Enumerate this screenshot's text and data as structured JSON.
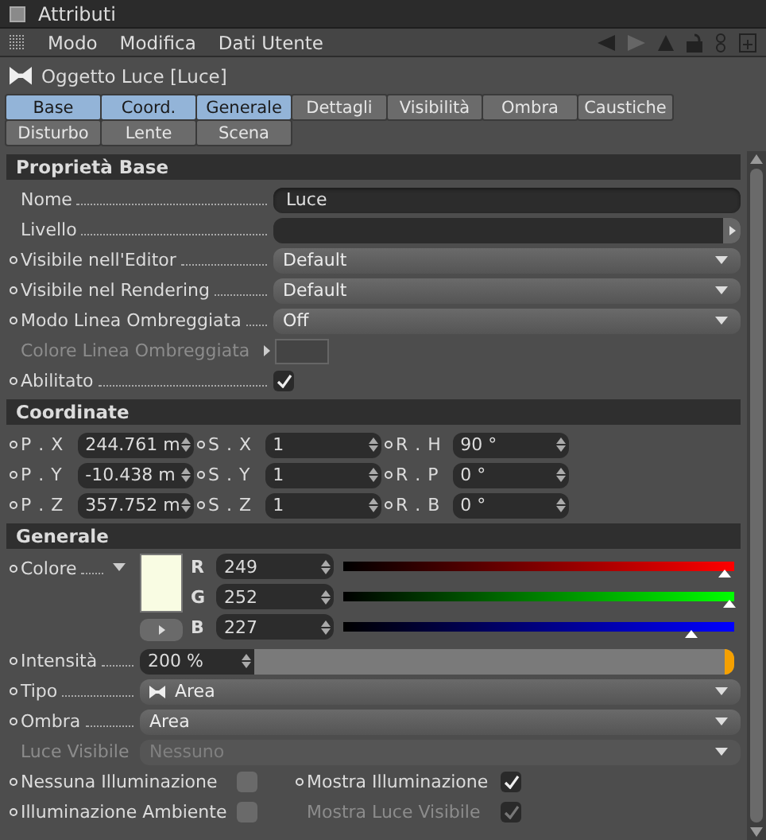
{
  "window": {
    "title": "Attributi"
  },
  "menu": [
    "Modo",
    "Modifica",
    "Dati Utente"
  ],
  "object": {
    "title": "Oggetto Luce [Luce]"
  },
  "tabs": [
    [
      {
        "label": "Base",
        "selected": true
      },
      {
        "label": "Coord.",
        "selected": true
      },
      {
        "label": "Generale",
        "selected": true
      },
      {
        "label": "Dettagli",
        "selected": false
      },
      {
        "label": "Visibilità",
        "selected": false
      },
      {
        "label": "Ombra",
        "selected": false
      },
      {
        "label": "Caustiche",
        "selected": false
      }
    ],
    [
      {
        "label": "Disturbo",
        "selected": false
      },
      {
        "label": "Lente",
        "selected": false
      },
      {
        "label": "Scena",
        "selected": false
      }
    ]
  ],
  "base": {
    "title": "Proprietà Base",
    "rows": [
      {
        "kind": "text",
        "label": "Nome",
        "value": "Luce",
        "animatable": false,
        "disabled": false
      },
      {
        "kind": "link",
        "label": "Livello",
        "animatable": false,
        "disabled": false
      },
      {
        "kind": "dropdown",
        "label": "Visibile nell'Editor",
        "value": "Default",
        "animatable": true,
        "disabled": false
      },
      {
        "kind": "dropdown",
        "label": "Visibile nel Rendering",
        "value": "Default",
        "animatable": true,
        "disabled": false
      },
      {
        "kind": "dropdown",
        "label": "Modo Linea Ombreggiata",
        "value": "Off",
        "animatable": true,
        "disabled": false
      },
      {
        "kind": "color",
        "label": "Colore Linea Ombreggiata",
        "animatable": false,
        "disabled": true
      },
      {
        "kind": "checkbox",
        "label": "Abilitato",
        "checked": true,
        "animatable": true,
        "disabled": false
      }
    ]
  },
  "coordinates": {
    "title": "Coordinate",
    "rows": [
      [
        {
          "label": "P . X",
          "value": "244.761 m"
        },
        {
          "label": "S . X",
          "value": "1"
        },
        {
          "label": "R . H",
          "value": "90 °"
        }
      ],
      [
        {
          "label": "P . Y",
          "value": "-10.438 m"
        },
        {
          "label": "S . Y",
          "value": "1"
        },
        {
          "label": "R . P",
          "value": "0 °"
        }
      ],
      [
        {
          "label": "P . Z",
          "value": "357.752 m"
        },
        {
          "label": "S . Z",
          "value": "1"
        },
        {
          "label": "R . B",
          "value": "0 °"
        }
      ]
    ]
  },
  "general": {
    "title": "Generale",
    "color": {
      "label": "Colore",
      "channels": [
        {
          "name": "R",
          "value": "249",
          "level": 0.976
        },
        {
          "name": "G",
          "value": "252",
          "level": 0.988
        },
        {
          "name": "B",
          "value": "227",
          "level": 0.89
        }
      ]
    },
    "intensity": {
      "label": "Intensità",
      "value": "200 %",
      "level": 1
    },
    "rows": [
      {
        "label": "Tipo",
        "value": "Area",
        "icon": true,
        "animatable": true,
        "disabled": false
      },
      {
        "label": "Ombra",
        "value": "Area",
        "icon": false,
        "animatable": true,
        "disabled": false
      },
      {
        "label": "Luce Visibile",
        "value": "Nessuno",
        "icon": false,
        "animatable": false,
        "disabled": true
      }
    ],
    "checks": [
      {
        "label": "Nessuna Illuminazione",
        "checked": false,
        "animatable": true,
        "disabled": false
      },
      {
        "label": "Mostra Illuminazione",
        "checked": true,
        "animatable": true,
        "disabled": false
      },
      {
        "label": "Illuminazione Ambiente",
        "checked": false,
        "animatable": true,
        "disabled": false
      },
      {
        "label": "Mostra Luce Visibile",
        "checked": true,
        "animatable": false,
        "disabled": true
      }
    ]
  }
}
